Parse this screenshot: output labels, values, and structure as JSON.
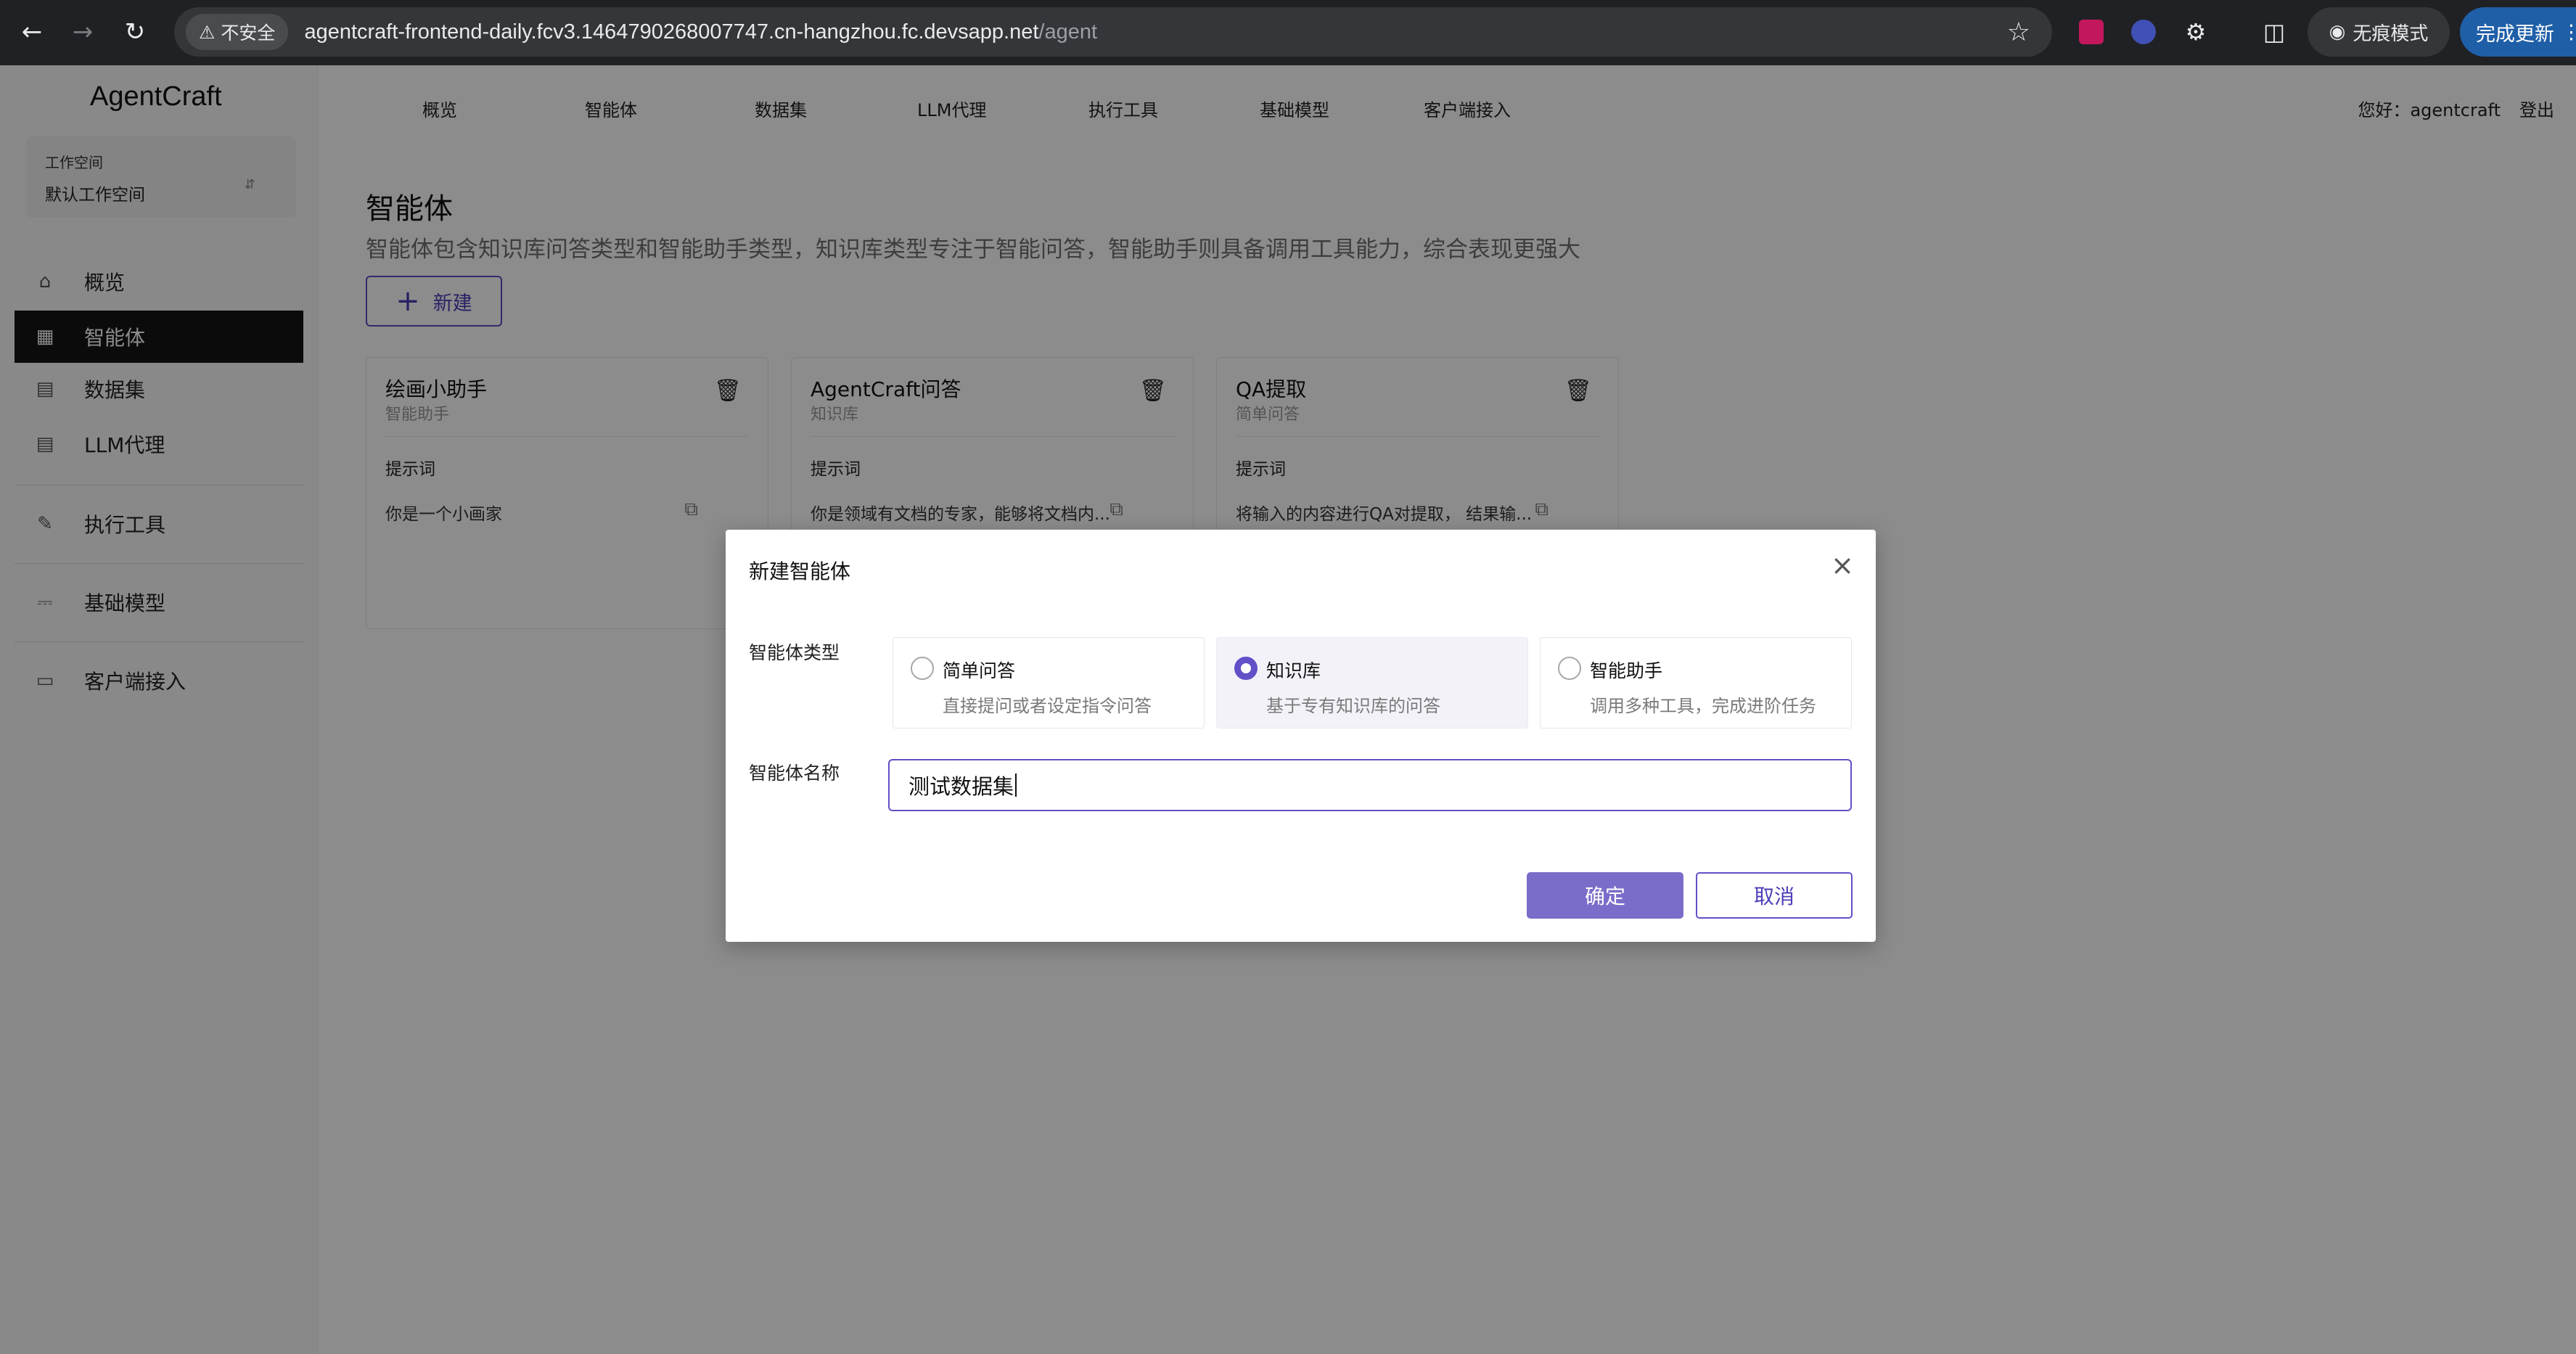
{
  "browser": {
    "insecure_label": "不安全",
    "url_host": "agentcraft-frontend-daily.fcv3.1464790268007747.cn-hangzhou.fc.devsapp.net",
    "url_path": "/agent",
    "incognito_label": "无痕模式",
    "update_label": "完成更新"
  },
  "sidebar": {
    "brand": "AgentCraft",
    "workspace_label": "工作空间",
    "workspace_value": "默认工作空间",
    "items": [
      {
        "label": "概览",
        "icon": "home-icon"
      },
      {
        "label": "智能体",
        "icon": "grid-icon"
      },
      {
        "label": "数据集",
        "icon": "database-icon"
      },
      {
        "label": "LLM代理",
        "icon": "server-icon"
      },
      {
        "label": "执行工具",
        "icon": "tool-icon"
      },
      {
        "label": "基础模型",
        "icon": "model-icon"
      },
      {
        "label": "客户端接入",
        "icon": "device-icon"
      }
    ]
  },
  "topnav": {
    "tabs": [
      "概览",
      "智能体",
      "数据集",
      "LLM代理",
      "执行工具",
      "基础模型",
      "客户端接入"
    ],
    "greeting": "您好：agentcraft",
    "logout": "登出"
  },
  "page": {
    "title": "智能体",
    "description": "智能体包含知识库问答类型和智能助手类型，知识库类型专注于智能问答，智能助手则具备调用工具能力，综合表现更强大",
    "new_button": "新建"
  },
  "cards": [
    {
      "title": "绘画小助手",
      "type": "智能助手",
      "prompt_label": "提示词",
      "prompt": "你是一个小画家"
    },
    {
      "title": "AgentCraft问答",
      "type": "知识库",
      "prompt_label": "提示词",
      "prompt": "你是领域有文档的专家，能够将文档内..."
    },
    {
      "title": "QA提取",
      "type": "简单问答",
      "prompt_label": "提示词",
      "prompt": "将输入的内容进行QA对提取， 结果输..."
    }
  ],
  "modal": {
    "title": "新建智能体",
    "type_label": "智能体类型",
    "name_label": "智能体名称",
    "options": [
      {
        "name": "简单问答",
        "desc": "直接提问或者设定指令问答",
        "selected": false
      },
      {
        "name": "知识库",
        "desc": "基于专有知识库的问答",
        "selected": true
      },
      {
        "name": "智能助手",
        "desc": "调用多种工具，完成进阶任务",
        "selected": false
      }
    ],
    "name_value": "测试数据集",
    "confirm": "确定",
    "cancel": "取消"
  },
  "colors": {
    "accent": "#6150c8",
    "confirm_bg": "#7a6dc9",
    "sidebar_active": "#141414"
  }
}
